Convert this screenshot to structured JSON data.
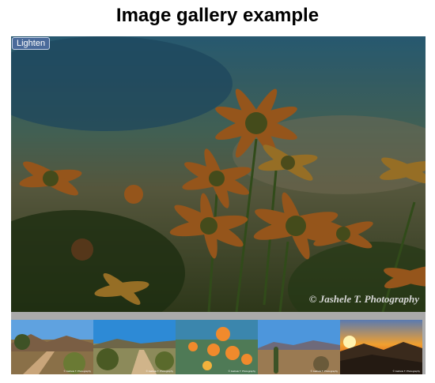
{
  "page": {
    "title": "Image gallery example"
  },
  "displayed_image": {
    "subject": "orange daisy flowers against a blurred field",
    "watermark": "© Jashele T. Photography"
  },
  "controls": {
    "darken_button_label": "Lighten"
  },
  "thumbnails": [
    {
      "subject": "dirt trail through desert hills",
      "credit": "© Jashele T. Photography"
    },
    {
      "subject": "desert path with shrubs under blue sky",
      "credit": "© Jashele T. Photography"
    },
    {
      "subject": "orange wildflowers close-up",
      "credit": "© Jashele T. Photography"
    },
    {
      "subject": "saguaro cactus in desert landscape",
      "credit": "© Jashele T. Photography"
    },
    {
      "subject": "sunset over mountain ridges",
      "credit": "© Jashele T. Photography"
    }
  ],
  "colors": {
    "button_bg": "#4a6a9a",
    "thumb_bar_bg": "#aaaaaa",
    "flower_orange": "#e8822a"
  }
}
